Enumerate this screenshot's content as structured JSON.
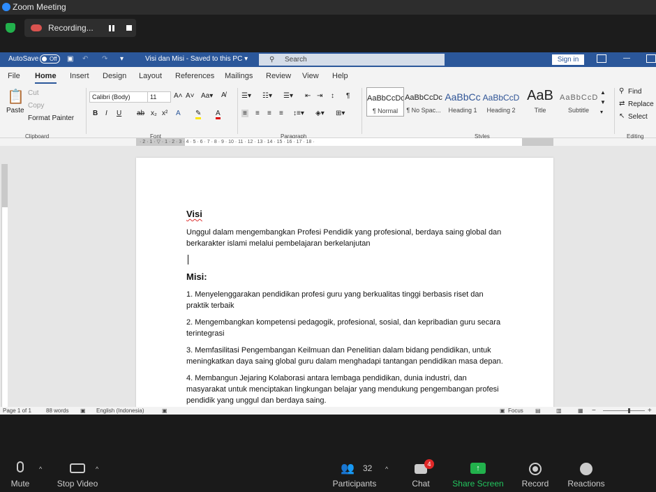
{
  "zoom": {
    "title": "Zoom Meeting",
    "recording": "Recording..."
  },
  "word": {
    "autosave": "AutoSave",
    "autosave_state": "Off",
    "doc_title": "Visi dan Misi  -  Saved to this PC  ▾",
    "search_placeholder": "Search",
    "signin": "Sign in",
    "tabs": [
      "File",
      "Home",
      "Insert",
      "Design",
      "Layout",
      "References",
      "Mailings",
      "Review",
      "View",
      "Help"
    ],
    "clipboard": {
      "paste": "Paste",
      "cut": "Cut",
      "copy": "Copy",
      "format_painter": "Format Painter",
      "group": "Clipboard"
    },
    "font": {
      "name": "Calibri (Body)",
      "size": "11",
      "group": "Font"
    },
    "paragraph": {
      "group": "Paragraph"
    },
    "styles": {
      "items": [
        {
          "preview": "AaBbCcDc",
          "name": "¶ Normal"
        },
        {
          "preview": "AaBbCcDc",
          "name": "¶ No Spac..."
        },
        {
          "preview": "AaBbCc",
          "name": "Heading 1"
        },
        {
          "preview": "AaBbCcD",
          "name": "Heading 2"
        },
        {
          "preview": "AaB",
          "name": "Title"
        },
        {
          "preview": "AaBbCcD",
          "name": "Subtitle"
        }
      ],
      "group": "Styles"
    },
    "editing": {
      "find": "Find",
      "replace": "Replace",
      "select": "Select",
      "group": "Editing"
    },
    "ruler": "· 2 · 1 · ▽ · 1 · 2 · 3 · 4 · 5 · 6 · 7 · 8 · 9 · 10 · 11 · 12 · 13 · 14 · 15 · 16 · 17 · 18 ·",
    "status": {
      "page": "Page 1 of 1",
      "words": "88 words",
      "language": "English (Indonesia)",
      "focus": "Focus"
    }
  },
  "document": {
    "visi_heading": "Visi",
    "visi_text": [
      "Unggul dalam mengembangkan  Profesi Pendidik yang profesional, berdaya saing global dan",
      "berkarakter islami melalui pembelajaran berkelanjutan"
    ],
    "misi_heading": "Misi:",
    "misi": [
      [
        "1. Menyelenggarakan pendidikan profesi guru yang berkualitas tinggi berbasis riset dan",
        "praktik terbaik"
      ],
      [
        "2. Mengembangkan kompetensi pedagogik, profesional, sosial, dan kepribadian guru secara",
        "terintegrasi"
      ],
      [
        "3. Memfasilitasi Pengembangan Keilmuan dan Penelitian dalam bidang pendidikan, untuk",
        "meningkatkan daya saing global guru dalam menghadapi tantangan pendidikan masa depan."
      ],
      [
        "4. Membangun Jejaring Kolaborasi antara lembaga pendidikan, dunia industri, dan",
        "masyarakat untuk menciptakan lingkungan belajar yang mendukung pengembangan profesi",
        "pendidik yang unggul dan berdaya saing."
      ]
    ]
  },
  "zoom_toolbar": {
    "mute": "Mute",
    "stop_video": "Stop Video",
    "participants": "Participants",
    "participants_count": "32",
    "chat": "Chat",
    "chat_badge": "4",
    "share_screen": "Share Screen",
    "record": "Record",
    "reactions": "Reactions"
  }
}
